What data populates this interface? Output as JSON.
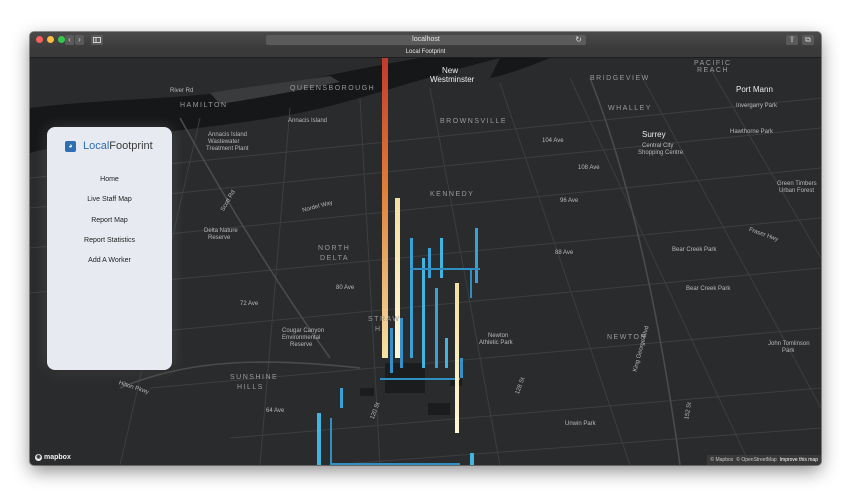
{
  "browser": {
    "url": "localhost",
    "tab_title": "Local Footprint",
    "back_icon": "chevron-left-icon",
    "forward_icon": "chevron-right-icon",
    "sidebar_icon": "sidebar-icon",
    "reload_icon": "reload-icon",
    "share_icon": "share-icon",
    "tabs_icon": "tabs-icon"
  },
  "brand": {
    "local": "Local",
    "footprint": "Footprint",
    "icon": "owl-logo-icon"
  },
  "menu": [
    {
      "label": "Home"
    },
    {
      "label": "Live Staff Map"
    },
    {
      "label": "Report Map"
    },
    {
      "label": "Report Statistics"
    },
    {
      "label": "Add A Worker"
    }
  ],
  "map": {
    "places": {
      "new_westminster_1": "New",
      "new_westminster_2": "Westminster",
      "port_mann": "Port Mann",
      "surrey": "Surrey",
      "kennedy": "KENNEDY",
      "north_delta_1": "NORTH",
      "north_delta_2": "DELTA",
      "newton": "NEWTON",
      "sunshine_1": "SUNSHINE",
      "sunshine_2": "HILLS",
      "hamilton": "HAMILTON",
      "queensborough": "QUEENSBOROUGH",
      "brownsville": "BROWNSVILLE",
      "bridgeview": "BRIDGEVIEW",
      "whalley": "WHALLEY",
      "strawberry_1": "STRAW",
      "strawberry_2": "H"
    },
    "pois": {
      "bear_creek": "Bear Creek Park",
      "bear_creek_2": "Bear Creek Park",
      "newton_athletic_1": "Newton",
      "newton_athletic_2": "Athletic Park",
      "cougar_1": "Cougar Canyon",
      "cougar_2": "Environmental",
      "cougar_3": "Reserve",
      "unwin": "Unwin Park",
      "delta_nature_1": "Delta Nature",
      "delta_nature_2": "Reserve",
      "tynehead_1": "Green Timbers",
      "tynehead_2": "Urban Forest",
      "john_1": "John Tomlinson",
      "john_2": "Park",
      "surrey_central_1": "Central City",
      "surrey_central_2": "Shopping Centre",
      "ebert_island": "Annacis Island",
      "annacis": "Annacis Island",
      "annacis_2": "Wastewater",
      "annacis_3": "Treatment Plant",
      "hawthorne": "Hawthorne Park",
      "invergarry": "Invergarry Park",
      "pacific": "PACIFIC",
      "reach": "REACH"
    },
    "roads": {
      "r1": "Hilton Pkwy",
      "r2": "72 Ave",
      "r3": "64 Ave",
      "r4": "80 Ave",
      "r5": "88 Ave",
      "r6": "96 Ave",
      "r7": "104 Ave",
      "r8": "108 Ave",
      "r9": "120 St",
      "r10": "128 St",
      "r11": "152 St",
      "r12": "King George Blvd",
      "r13": "Scott Rd",
      "r14": "River Rd",
      "r15": "Nordel Way",
      "r16": "Fraser Hwy"
    }
  },
  "footer": {
    "logo": "mapbox",
    "logo_icon": "mapbox-icon",
    "attrib_mapbox": "© Mapbox",
    "attrib_osm": "© OpenStreetMap",
    "improve": "Improve this map"
  }
}
